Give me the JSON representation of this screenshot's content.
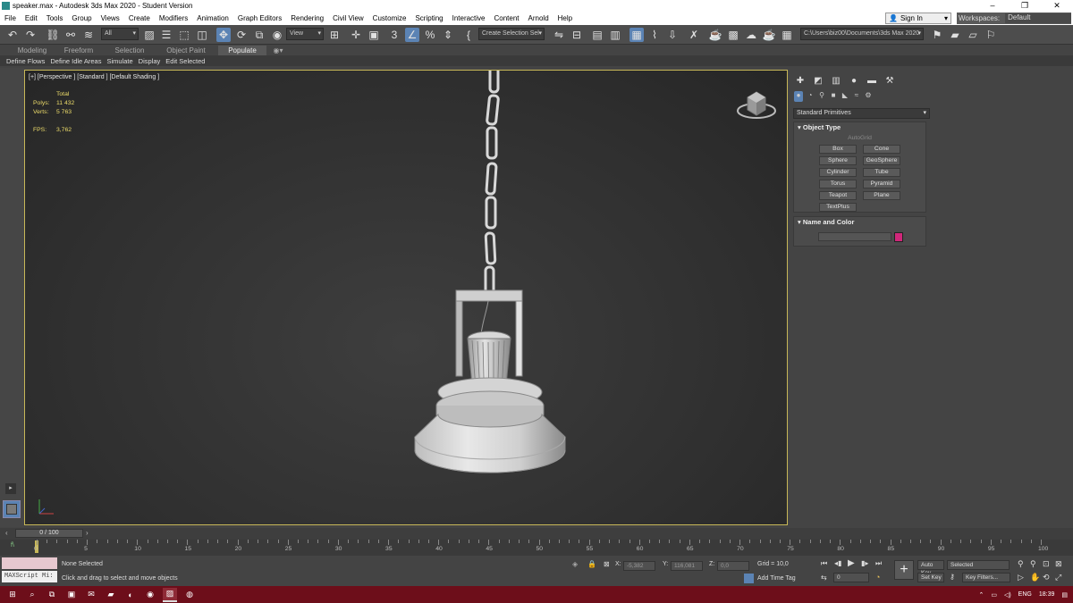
{
  "window": {
    "title": "speaker.max - Autodesk 3ds Max 2020 - Student Version",
    "minimize": "–",
    "maximize": "❐",
    "close": "✕"
  },
  "menu": {
    "items": [
      "File",
      "Edit",
      "Tools",
      "Group",
      "Views",
      "Create",
      "Modifiers",
      "Animation",
      "Graph Editors",
      "Rendering",
      "Civil View",
      "Customize",
      "Scripting",
      "Interactive",
      "Content",
      "Arnold",
      "Help"
    ],
    "signin": "Sign In",
    "workspace_label": "Workspaces:",
    "workspace_value": "Default"
  },
  "toolbar": {
    "filter": "All",
    "ref_coord": "View",
    "create_selection_set": "Create Selection Sel",
    "project_path": "C:\\Users\\biz00\\Documents\\3ds Max 2020"
  },
  "ribbon": {
    "tabs": [
      "Modeling",
      "Freeform",
      "Selection",
      "Object Paint",
      "Populate"
    ],
    "active_tab": "Populate",
    "sub_items": [
      "Define Flows",
      "Define Idle Areas",
      "Simulate",
      "Display",
      "Edit Selected"
    ]
  },
  "viewport": {
    "label": "[+] [Perspective ] [Standard ] [Default Shading ]",
    "stats": {
      "header": "Total",
      "polys_label": "Polys:",
      "polys": "11 432",
      "verts_label": "Verts:",
      "verts": "5 763",
      "fps_label": "FPS:",
      "fps": "3,762"
    }
  },
  "command_panel": {
    "primitives_dropdown": "Standard Primitives",
    "object_type_title": "Object Type",
    "autogrid": "AutoGrid",
    "buttons": [
      "Box",
      "Cone",
      "Sphere",
      "GeoSphere",
      "Cylinder",
      "Tube",
      "Torus",
      "Pyramid",
      "Teapot",
      "Plane",
      "TextPlus"
    ],
    "name_color_title": "Name and Color",
    "object_color": "#d0277a"
  },
  "timeline": {
    "slider": "0 / 100",
    "ticks": [
      "0",
      "5",
      "10",
      "15",
      "20",
      "25",
      "30",
      "35",
      "40",
      "45",
      "50",
      "55",
      "60",
      "65",
      "70",
      "75",
      "80",
      "85",
      "90",
      "95",
      "100"
    ]
  },
  "status": {
    "maxscript": "MAXScript Mi:",
    "selection": "None Selected",
    "prompt": "Click and drag to select and move objects",
    "x_label": "X:",
    "x": "-5,382",
    "y_label": "Y:",
    "y": "116,081",
    "z_label": "Z:",
    "z": "0,0",
    "grid": "Grid = 10,0",
    "add_time_tag": "Add Time Tag",
    "frame": "0",
    "auto_key": "Auto Key",
    "set_key": "Set Key",
    "selected": "Selected",
    "key_filters": "Key Filters..."
  },
  "taskbar": {
    "lang": "ENG",
    "time": "18:39"
  }
}
